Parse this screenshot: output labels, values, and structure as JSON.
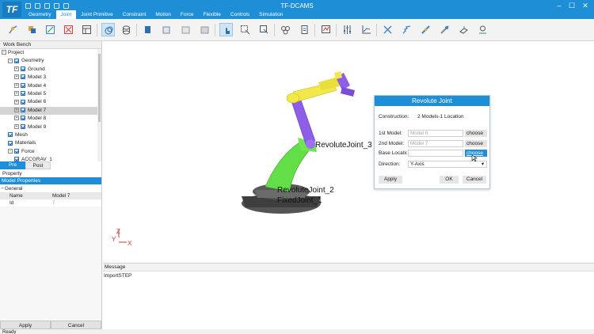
{
  "app": {
    "logo": "TF",
    "title": "TF-DCAMS"
  },
  "colors": {
    "accent": "#1e8fd6",
    "robot_yellow": "#f3e84a",
    "robot_purple": "#8d5fe6",
    "robot_green": "#62de47",
    "base_gray": "#4a4a4a"
  },
  "menu": {
    "tabs": [
      "Geometry",
      "Joint",
      "Joint Primitive",
      "Constraint",
      "Motion",
      "Force",
      "Flexible",
      "Controls",
      "Simulation"
    ],
    "active": "Joint"
  },
  "workbench": {
    "title": "Work Bench",
    "tree": [
      {
        "label": "Project",
        "level": 0,
        "expand": "minus",
        "check": false
      },
      {
        "label": "Geometry",
        "level": 1,
        "expand": "minus",
        "check": true
      },
      {
        "label": "Ground",
        "level": 2,
        "expand": "plus",
        "check": true
      },
      {
        "label": "Model 3",
        "level": 2,
        "expand": "plus",
        "check": true
      },
      {
        "label": "Model 4",
        "level": 2,
        "expand": "plus",
        "check": true
      },
      {
        "label": "Model 5",
        "level": 2,
        "expand": "plus",
        "check": true
      },
      {
        "label": "Model 6",
        "level": 2,
        "expand": "plus",
        "check": true
      },
      {
        "label": "Model 7",
        "level": 2,
        "expand": "plus",
        "check": true,
        "selected": true
      },
      {
        "label": "Model 8",
        "level": 2,
        "expand": "plus",
        "check": true
      },
      {
        "label": "Model 9",
        "level": 2,
        "expand": "plus",
        "check": true
      },
      {
        "label": "Mesh",
        "level": 1,
        "expand": "none",
        "check": true
      },
      {
        "label": "Materials",
        "level": 1,
        "expand": "none",
        "check": true
      },
      {
        "label": "Force",
        "level": 1,
        "expand": "minus",
        "check": true
      },
      {
        "label": "ACCGRAV_1",
        "level": 2,
        "expand": "none",
        "check": true
      }
    ],
    "tabs": [
      "Pre",
      "Post"
    ]
  },
  "property": {
    "title": "Property",
    "section": "Model Properties",
    "group": "General",
    "rows": [
      {
        "key": "Name",
        "value": "Model 7"
      },
      {
        "key": "Id",
        "value": "7"
      }
    ],
    "apply": "Apply",
    "cancel": "Cancel"
  },
  "viewport": {
    "labels": {
      "joint3": "RevoluteJoint_3",
      "joint2": "RevoluteJoint_2",
      "fixed1": "FixedJoint_1"
    },
    "axes": {
      "z": "Z",
      "y": "Y",
      "x": "X"
    }
  },
  "dialog": {
    "title": "Revolute Joint",
    "construction_label": "Construction:",
    "construction_value": "2 Models-1 Location",
    "first_model_label": "1st Model:",
    "first_model_value": "Model 6",
    "second_model_label": "2nd Model:",
    "second_model_value": "Model 7",
    "base_location_label": "Base Location:",
    "choose": "choose",
    "direction_label": "Direction:",
    "direction_value": "Y-Axis",
    "apply": "Apply",
    "ok": "OK",
    "cancel": "Cancel"
  },
  "message": {
    "title": "Message",
    "text": "ImportSTEP"
  },
  "status": {
    "text": "Ready"
  }
}
